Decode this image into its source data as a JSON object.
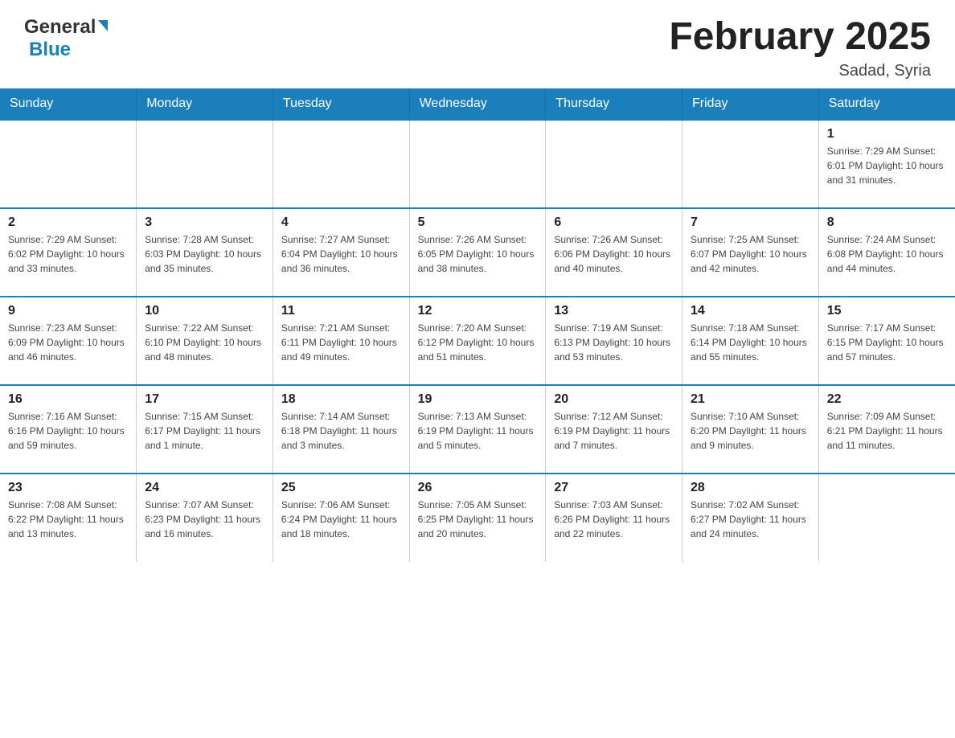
{
  "header": {
    "logo_general": "General",
    "logo_blue": "Blue",
    "month_title": "February 2025",
    "location": "Sadad, Syria"
  },
  "weekdays": [
    "Sunday",
    "Monday",
    "Tuesday",
    "Wednesday",
    "Thursday",
    "Friday",
    "Saturday"
  ],
  "weeks": [
    [
      {
        "day": "",
        "info": ""
      },
      {
        "day": "",
        "info": ""
      },
      {
        "day": "",
        "info": ""
      },
      {
        "day": "",
        "info": ""
      },
      {
        "day": "",
        "info": ""
      },
      {
        "day": "",
        "info": ""
      },
      {
        "day": "1",
        "info": "Sunrise: 7:29 AM\nSunset: 6:01 PM\nDaylight: 10 hours\nand 31 minutes."
      }
    ],
    [
      {
        "day": "2",
        "info": "Sunrise: 7:29 AM\nSunset: 6:02 PM\nDaylight: 10 hours\nand 33 minutes."
      },
      {
        "day": "3",
        "info": "Sunrise: 7:28 AM\nSunset: 6:03 PM\nDaylight: 10 hours\nand 35 minutes."
      },
      {
        "day": "4",
        "info": "Sunrise: 7:27 AM\nSunset: 6:04 PM\nDaylight: 10 hours\nand 36 minutes."
      },
      {
        "day": "5",
        "info": "Sunrise: 7:26 AM\nSunset: 6:05 PM\nDaylight: 10 hours\nand 38 minutes."
      },
      {
        "day": "6",
        "info": "Sunrise: 7:26 AM\nSunset: 6:06 PM\nDaylight: 10 hours\nand 40 minutes."
      },
      {
        "day": "7",
        "info": "Sunrise: 7:25 AM\nSunset: 6:07 PM\nDaylight: 10 hours\nand 42 minutes."
      },
      {
        "day": "8",
        "info": "Sunrise: 7:24 AM\nSunset: 6:08 PM\nDaylight: 10 hours\nand 44 minutes."
      }
    ],
    [
      {
        "day": "9",
        "info": "Sunrise: 7:23 AM\nSunset: 6:09 PM\nDaylight: 10 hours\nand 46 minutes."
      },
      {
        "day": "10",
        "info": "Sunrise: 7:22 AM\nSunset: 6:10 PM\nDaylight: 10 hours\nand 48 minutes."
      },
      {
        "day": "11",
        "info": "Sunrise: 7:21 AM\nSunset: 6:11 PM\nDaylight: 10 hours\nand 49 minutes."
      },
      {
        "day": "12",
        "info": "Sunrise: 7:20 AM\nSunset: 6:12 PM\nDaylight: 10 hours\nand 51 minutes."
      },
      {
        "day": "13",
        "info": "Sunrise: 7:19 AM\nSunset: 6:13 PM\nDaylight: 10 hours\nand 53 minutes."
      },
      {
        "day": "14",
        "info": "Sunrise: 7:18 AM\nSunset: 6:14 PM\nDaylight: 10 hours\nand 55 minutes."
      },
      {
        "day": "15",
        "info": "Sunrise: 7:17 AM\nSunset: 6:15 PM\nDaylight: 10 hours\nand 57 minutes."
      }
    ],
    [
      {
        "day": "16",
        "info": "Sunrise: 7:16 AM\nSunset: 6:16 PM\nDaylight: 10 hours\nand 59 minutes."
      },
      {
        "day": "17",
        "info": "Sunrise: 7:15 AM\nSunset: 6:17 PM\nDaylight: 11 hours\nand 1 minute."
      },
      {
        "day": "18",
        "info": "Sunrise: 7:14 AM\nSunset: 6:18 PM\nDaylight: 11 hours\nand 3 minutes."
      },
      {
        "day": "19",
        "info": "Sunrise: 7:13 AM\nSunset: 6:19 PM\nDaylight: 11 hours\nand 5 minutes."
      },
      {
        "day": "20",
        "info": "Sunrise: 7:12 AM\nSunset: 6:19 PM\nDaylight: 11 hours\nand 7 minutes."
      },
      {
        "day": "21",
        "info": "Sunrise: 7:10 AM\nSunset: 6:20 PM\nDaylight: 11 hours\nand 9 minutes."
      },
      {
        "day": "22",
        "info": "Sunrise: 7:09 AM\nSunset: 6:21 PM\nDaylight: 11 hours\nand 11 minutes."
      }
    ],
    [
      {
        "day": "23",
        "info": "Sunrise: 7:08 AM\nSunset: 6:22 PM\nDaylight: 11 hours\nand 13 minutes."
      },
      {
        "day": "24",
        "info": "Sunrise: 7:07 AM\nSunset: 6:23 PM\nDaylight: 11 hours\nand 16 minutes."
      },
      {
        "day": "25",
        "info": "Sunrise: 7:06 AM\nSunset: 6:24 PM\nDaylight: 11 hours\nand 18 minutes."
      },
      {
        "day": "26",
        "info": "Sunrise: 7:05 AM\nSunset: 6:25 PM\nDaylight: 11 hours\nand 20 minutes."
      },
      {
        "day": "27",
        "info": "Sunrise: 7:03 AM\nSunset: 6:26 PM\nDaylight: 11 hours\nand 22 minutes."
      },
      {
        "day": "28",
        "info": "Sunrise: 7:02 AM\nSunset: 6:27 PM\nDaylight: 11 hours\nand 24 minutes."
      },
      {
        "day": "",
        "info": ""
      }
    ]
  ]
}
